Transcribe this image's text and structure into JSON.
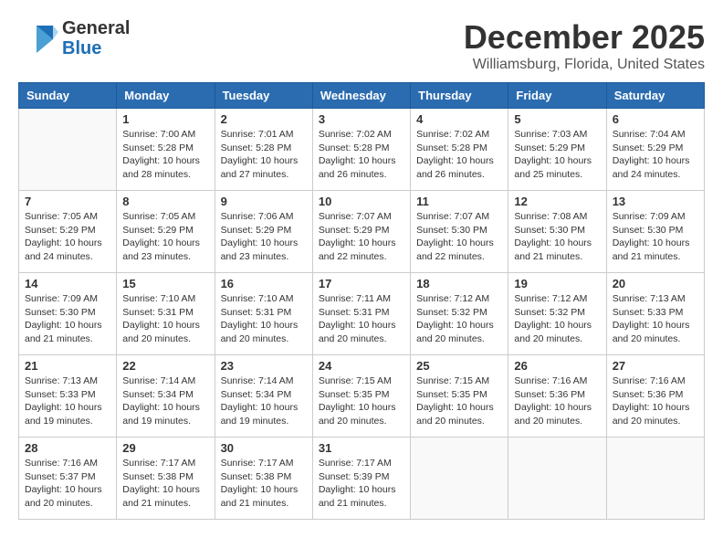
{
  "logo": {
    "general": "General",
    "blue": "Blue"
  },
  "title": "December 2025",
  "subtitle": "Williamsburg, Florida, United States",
  "weekdays": [
    "Sunday",
    "Monday",
    "Tuesday",
    "Wednesday",
    "Thursday",
    "Friday",
    "Saturday"
  ],
  "weeks": [
    [
      {
        "day": "",
        "sunrise": "",
        "sunset": "",
        "daylight": ""
      },
      {
        "day": "1",
        "sunrise": "Sunrise: 7:00 AM",
        "sunset": "Sunset: 5:28 PM",
        "daylight": "Daylight: 10 hours and 28 minutes."
      },
      {
        "day": "2",
        "sunrise": "Sunrise: 7:01 AM",
        "sunset": "Sunset: 5:28 PM",
        "daylight": "Daylight: 10 hours and 27 minutes."
      },
      {
        "day": "3",
        "sunrise": "Sunrise: 7:02 AM",
        "sunset": "Sunset: 5:28 PM",
        "daylight": "Daylight: 10 hours and 26 minutes."
      },
      {
        "day": "4",
        "sunrise": "Sunrise: 7:02 AM",
        "sunset": "Sunset: 5:28 PM",
        "daylight": "Daylight: 10 hours and 26 minutes."
      },
      {
        "day": "5",
        "sunrise": "Sunrise: 7:03 AM",
        "sunset": "Sunset: 5:29 PM",
        "daylight": "Daylight: 10 hours and 25 minutes."
      },
      {
        "day": "6",
        "sunrise": "Sunrise: 7:04 AM",
        "sunset": "Sunset: 5:29 PM",
        "daylight": "Daylight: 10 hours and 24 minutes."
      }
    ],
    [
      {
        "day": "7",
        "sunrise": "Sunrise: 7:05 AM",
        "sunset": "Sunset: 5:29 PM",
        "daylight": "Daylight: 10 hours and 24 minutes."
      },
      {
        "day": "8",
        "sunrise": "Sunrise: 7:05 AM",
        "sunset": "Sunset: 5:29 PM",
        "daylight": "Daylight: 10 hours and 23 minutes."
      },
      {
        "day": "9",
        "sunrise": "Sunrise: 7:06 AM",
        "sunset": "Sunset: 5:29 PM",
        "daylight": "Daylight: 10 hours and 23 minutes."
      },
      {
        "day": "10",
        "sunrise": "Sunrise: 7:07 AM",
        "sunset": "Sunset: 5:29 PM",
        "daylight": "Daylight: 10 hours and 22 minutes."
      },
      {
        "day": "11",
        "sunrise": "Sunrise: 7:07 AM",
        "sunset": "Sunset: 5:30 PM",
        "daylight": "Daylight: 10 hours and 22 minutes."
      },
      {
        "day": "12",
        "sunrise": "Sunrise: 7:08 AM",
        "sunset": "Sunset: 5:30 PM",
        "daylight": "Daylight: 10 hours and 21 minutes."
      },
      {
        "day": "13",
        "sunrise": "Sunrise: 7:09 AM",
        "sunset": "Sunset: 5:30 PM",
        "daylight": "Daylight: 10 hours and 21 minutes."
      }
    ],
    [
      {
        "day": "14",
        "sunrise": "Sunrise: 7:09 AM",
        "sunset": "Sunset: 5:30 PM",
        "daylight": "Daylight: 10 hours and 21 minutes."
      },
      {
        "day": "15",
        "sunrise": "Sunrise: 7:10 AM",
        "sunset": "Sunset: 5:31 PM",
        "daylight": "Daylight: 10 hours and 20 minutes."
      },
      {
        "day": "16",
        "sunrise": "Sunrise: 7:10 AM",
        "sunset": "Sunset: 5:31 PM",
        "daylight": "Daylight: 10 hours and 20 minutes."
      },
      {
        "day": "17",
        "sunrise": "Sunrise: 7:11 AM",
        "sunset": "Sunset: 5:31 PM",
        "daylight": "Daylight: 10 hours and 20 minutes."
      },
      {
        "day": "18",
        "sunrise": "Sunrise: 7:12 AM",
        "sunset": "Sunset: 5:32 PM",
        "daylight": "Daylight: 10 hours and 20 minutes."
      },
      {
        "day": "19",
        "sunrise": "Sunrise: 7:12 AM",
        "sunset": "Sunset: 5:32 PM",
        "daylight": "Daylight: 10 hours and 20 minutes."
      },
      {
        "day": "20",
        "sunrise": "Sunrise: 7:13 AM",
        "sunset": "Sunset: 5:33 PM",
        "daylight": "Daylight: 10 hours and 20 minutes."
      }
    ],
    [
      {
        "day": "21",
        "sunrise": "Sunrise: 7:13 AM",
        "sunset": "Sunset: 5:33 PM",
        "daylight": "Daylight: 10 hours and 19 minutes."
      },
      {
        "day": "22",
        "sunrise": "Sunrise: 7:14 AM",
        "sunset": "Sunset: 5:34 PM",
        "daylight": "Daylight: 10 hours and 19 minutes."
      },
      {
        "day": "23",
        "sunrise": "Sunrise: 7:14 AM",
        "sunset": "Sunset: 5:34 PM",
        "daylight": "Daylight: 10 hours and 19 minutes."
      },
      {
        "day": "24",
        "sunrise": "Sunrise: 7:15 AM",
        "sunset": "Sunset: 5:35 PM",
        "daylight": "Daylight: 10 hours and 20 minutes."
      },
      {
        "day": "25",
        "sunrise": "Sunrise: 7:15 AM",
        "sunset": "Sunset: 5:35 PM",
        "daylight": "Daylight: 10 hours and 20 minutes."
      },
      {
        "day": "26",
        "sunrise": "Sunrise: 7:16 AM",
        "sunset": "Sunset: 5:36 PM",
        "daylight": "Daylight: 10 hours and 20 minutes."
      },
      {
        "day": "27",
        "sunrise": "Sunrise: 7:16 AM",
        "sunset": "Sunset: 5:36 PM",
        "daylight": "Daylight: 10 hours and 20 minutes."
      }
    ],
    [
      {
        "day": "28",
        "sunrise": "Sunrise: 7:16 AM",
        "sunset": "Sunset: 5:37 PM",
        "daylight": "Daylight: 10 hours and 20 minutes."
      },
      {
        "day": "29",
        "sunrise": "Sunrise: 7:17 AM",
        "sunset": "Sunset: 5:38 PM",
        "daylight": "Daylight: 10 hours and 21 minutes."
      },
      {
        "day": "30",
        "sunrise": "Sunrise: 7:17 AM",
        "sunset": "Sunset: 5:38 PM",
        "daylight": "Daylight: 10 hours and 21 minutes."
      },
      {
        "day": "31",
        "sunrise": "Sunrise: 7:17 AM",
        "sunset": "Sunset: 5:39 PM",
        "daylight": "Daylight: 10 hours and 21 minutes."
      },
      {
        "day": "",
        "sunrise": "",
        "sunset": "",
        "daylight": ""
      },
      {
        "day": "",
        "sunrise": "",
        "sunset": "",
        "daylight": ""
      },
      {
        "day": "",
        "sunrise": "",
        "sunset": "",
        "daylight": ""
      }
    ]
  ]
}
